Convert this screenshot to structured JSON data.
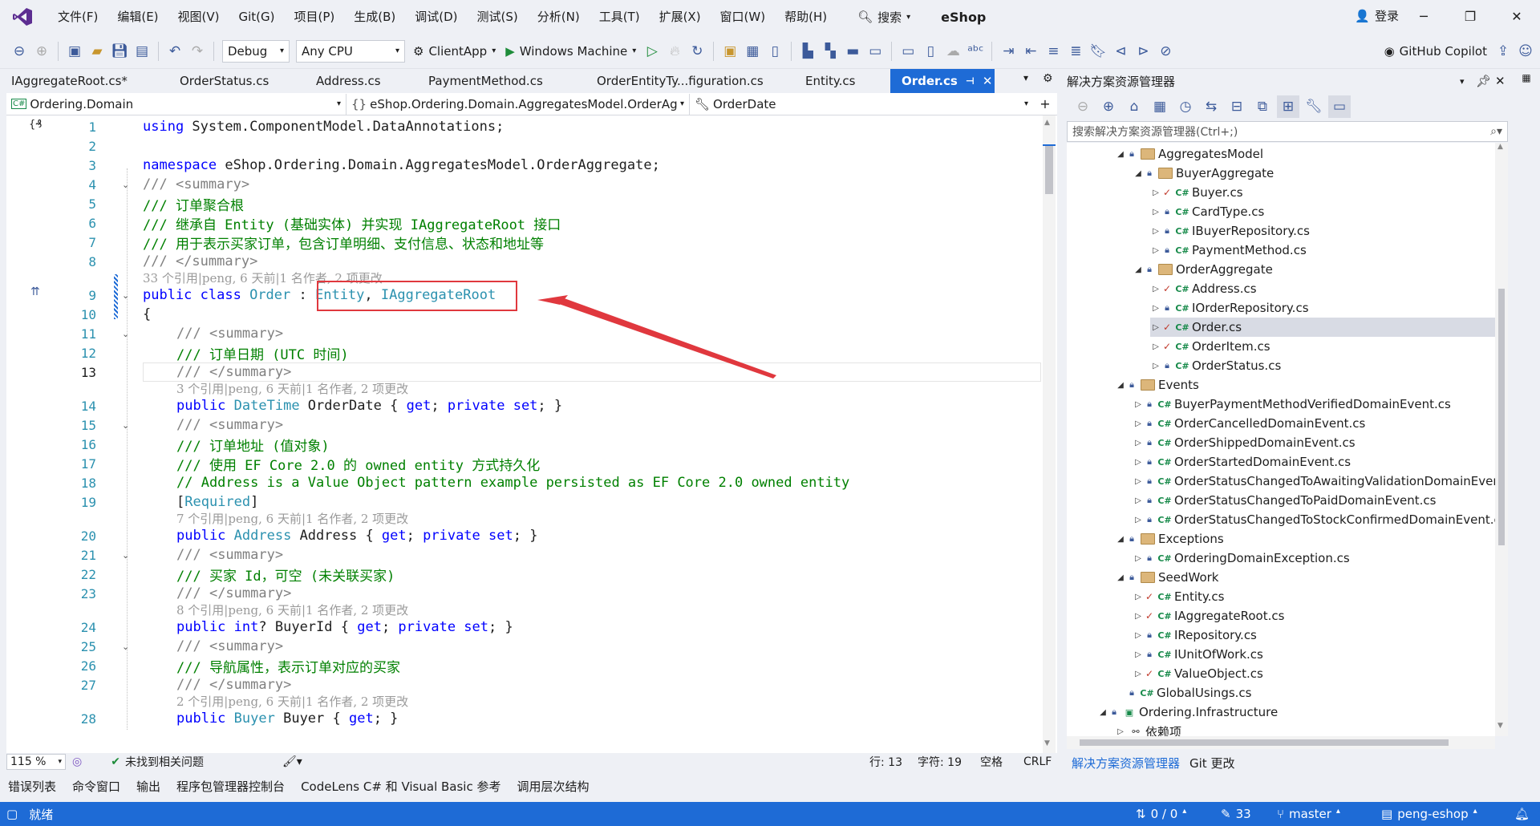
{
  "menubar": {
    "items": [
      "文件(F)",
      "编辑(E)",
      "视图(V)",
      "Git(G)",
      "项目(P)",
      "生成(B)",
      "调试(D)",
      "测试(S)",
      "分析(N)",
      "工具(T)",
      "扩展(X)",
      "窗口(W)",
      "帮助(H)"
    ],
    "search_label": "搜索",
    "app_title": "eShop",
    "login_label": "登录"
  },
  "toolbar": {
    "config": "Debug",
    "platform": "Any CPU",
    "startup": "ClientApp",
    "run_target": "Windows Machine",
    "copilot": "GitHub Copilot"
  },
  "tabs": [
    {
      "label": "IAggregateRoot.cs*"
    },
    {
      "label": "OrderStatus.cs"
    },
    {
      "label": "Address.cs"
    },
    {
      "label": "PaymentMethod.cs"
    },
    {
      "label": "OrderEntityTy...figuration.cs"
    },
    {
      "label": "Entity.cs"
    },
    {
      "label": "Order.cs"
    }
  ],
  "navbar": {
    "project": "Ordering.Domain",
    "namespace": "eShop.Ordering.Domain.AggregatesModel.OrderAg",
    "member": "OrderDate"
  },
  "editor": {
    "lines": [
      {
        "n": "1",
        "t": "using"
      },
      {
        "n": "2"
      },
      {
        "n": "3"
      },
      {
        "n": "4"
      },
      {
        "n": "5"
      },
      {
        "n": "6"
      },
      {
        "n": "7"
      },
      {
        "n": "8"
      },
      {
        "n": "9"
      },
      {
        "n": "10"
      },
      {
        "n": "11"
      },
      {
        "n": "12"
      },
      {
        "n": "13"
      },
      {
        "n": "14"
      },
      {
        "n": "15"
      },
      {
        "n": "16"
      },
      {
        "n": "17"
      },
      {
        "n": "18"
      },
      {
        "n": "19"
      },
      {
        "n": "20"
      },
      {
        "n": "21"
      },
      {
        "n": "22"
      },
      {
        "n": "23"
      },
      {
        "n": "24"
      },
      {
        "n": "25"
      },
      {
        "n": "26"
      },
      {
        "n": "27"
      },
      {
        "n": "28"
      }
    ],
    "code": {
      "l1": "using System.ComponentModel.DataAnnotations;",
      "l3a": "namespace",
      "l3b": " eShop.Ordering.Domain.AggregatesModel.OrderAggregate;",
      "l4a": "/// ",
      "l4b": "<summary>",
      "l5": "/// 订单聚合根",
      "l6": "/// 继承自 Entity (基础实体) 并实现 IAggregateRoot 接口",
      "l7": "/// 用于表示买家订单，包含订单明细、支付信息、状态和地址等",
      "l8a": "/// ",
      "l8b": "</summary>",
      "lens9": "33 个引用|peng, 6 天前|1 名作者, 2 项更改",
      "l9a": "public class",
      "l9b": "Order",
      "l9c": " : ",
      "l9d": "Entity",
      "l9e": ", ",
      "l9f": "IAggregateRoot",
      "l10": "{",
      "l11b": "<summary>",
      "l12": "/// 订单日期 (UTC 时间)",
      "l13b": "</summary>",
      "lens14": "3 个引用|peng, 6 天前|1 名作者, 2 项更改",
      "l14a": "public",
      "l14b": "DateTime",
      "l14c": " OrderDate { ",
      "l14d": "get",
      "l14e": "; ",
      "l14f": "private set",
      "l14g": "; }",
      "l16": "/// 订单地址 (值对象)",
      "l17": "/// 使用 EF Core 2.0 的 owned entity 方式持久化",
      "l18": "// Address is a Value Object pattern example persisted as EF Core 2.0 owned entity",
      "l19a": "[",
      "l19b": "Required",
      "l19c": "]",
      "lens20": "7 个引用|peng, 6 天前|1 名作者, 2 项更改",
      "l20b": "Address",
      "l20c": " Address { ",
      "l22": "/// 买家 Id，可空 (未关联买家)",
      "lens24": "8 个引用|peng, 6 天前|1 名作者, 2 项更改",
      "l24b": "int",
      "l24c": "? BuyerId { ",
      "l26": "/// 导航属性，表示订单对应的买家",
      "lens28": "2 个引用|peng, 6 天前|1 名作者, 2 项更改",
      "l28b": "Buyer",
      "l28c": " Buyer { ",
      "l28g": "; }",
      "comment_prefix": "/// "
    }
  },
  "editor_status": {
    "zoom": "115 %",
    "issues": "未找到相关问题",
    "line": "行: 13",
    "col": "字符: 19",
    "spaces": "空格",
    "eol": "CRLF"
  },
  "bottom_tabs": [
    "错误列表",
    "命令窗口",
    "输出",
    "程序包管理器控制台",
    "CodeLens C# 和 Visual Basic 参考",
    "调用层次结构"
  ],
  "statusbar": {
    "ready": "就绪",
    "sync": "0 / 0",
    "edits": "33",
    "branch": "master",
    "repo": "peng-eshop"
  },
  "solution_explorer": {
    "title": "解决方案资源管理器",
    "search_placeholder": "搜索解决方案资源管理器(Ctrl+;)",
    "tree": [
      {
        "label": "AggregatesModel",
        "level": 0,
        "type": "folder",
        "exp": "open"
      },
      {
        "label": "BuyerAggregate",
        "level": 1,
        "type": "folder",
        "exp": "open"
      },
      {
        "label": "Buyer.cs",
        "level": 2,
        "type": "cs",
        "mark": "check"
      },
      {
        "label": "CardType.cs",
        "level": 2,
        "type": "cs",
        "mark": "lock"
      },
      {
        "label": "IBuyerRepository.cs",
        "level": 2,
        "type": "cs",
        "mark": "lock"
      },
      {
        "label": "PaymentMethod.cs",
        "level": 2,
        "type": "cs",
        "mark": "lock"
      },
      {
        "label": "OrderAggregate",
        "level": 1,
        "type": "folder",
        "exp": "open"
      },
      {
        "label": "Address.cs",
        "level": 2,
        "type": "cs",
        "mark": "check"
      },
      {
        "label": "IOrderRepository.cs",
        "level": 2,
        "type": "cs",
        "mark": "lock"
      },
      {
        "label": "Order.cs",
        "level": 2,
        "type": "cs",
        "mark": "check",
        "selected": true
      },
      {
        "label": "OrderItem.cs",
        "level": 2,
        "type": "cs",
        "mark": "check"
      },
      {
        "label": "OrderStatus.cs",
        "level": 2,
        "type": "cs",
        "mark": "lock"
      },
      {
        "label": "Events",
        "level": 0,
        "type": "folder",
        "exp": "open"
      },
      {
        "label": "BuyerPaymentMethodVerifiedDomainEvent.cs",
        "level": 1,
        "type": "cs",
        "mark": "lock"
      },
      {
        "label": "OrderCancelledDomainEvent.cs",
        "level": 1,
        "type": "cs",
        "mark": "lock"
      },
      {
        "label": "OrderShippedDomainEvent.cs",
        "level": 1,
        "type": "cs",
        "mark": "lock"
      },
      {
        "label": "OrderStartedDomainEvent.cs",
        "level": 1,
        "type": "cs",
        "mark": "lock"
      },
      {
        "label": "OrderStatusChangedToAwaitingValidationDomainEven",
        "level": 1,
        "type": "cs",
        "mark": "lock"
      },
      {
        "label": "OrderStatusChangedToPaidDomainEvent.cs",
        "level": 1,
        "type": "cs",
        "mark": "lock"
      },
      {
        "label": "OrderStatusChangedToStockConfirmedDomainEvent.c",
        "level": 1,
        "type": "cs",
        "mark": "lock"
      },
      {
        "label": "Exceptions",
        "level": 0,
        "type": "folder",
        "exp": "open"
      },
      {
        "label": "OrderingDomainException.cs",
        "level": 1,
        "type": "cs",
        "mark": "lock"
      },
      {
        "label": "SeedWork",
        "level": 0,
        "type": "folder",
        "exp": "open"
      },
      {
        "label": "Entity.cs",
        "level": 1,
        "type": "cs",
        "mark": "check"
      },
      {
        "label": "IAggregateRoot.cs",
        "level": 1,
        "type": "cs",
        "mark": "check"
      },
      {
        "label": "IRepository.cs",
        "level": 1,
        "type": "cs",
        "mark": "lock"
      },
      {
        "label": "IUnitOfWork.cs",
        "level": 1,
        "type": "cs",
        "mark": "lock"
      },
      {
        "label": "ValueObject.cs",
        "level": 1,
        "type": "cs",
        "mark": "check"
      },
      {
        "label": "GlobalUsings.cs",
        "level": 0,
        "type": "cs",
        "mark": "lock",
        "noexp": true
      },
      {
        "label": "Ordering.Infrastructure",
        "level": -1,
        "type": "project",
        "exp": "open"
      },
      {
        "label": "依赖项",
        "level": 0,
        "type": "deps"
      }
    ],
    "bottom_tabs": [
      "解决方案资源管理器",
      "Git 更改"
    ]
  },
  "colors": {
    "accent": "#1e6bd6",
    "highlight_box": "#e0383e",
    "arrow": "#e0383e"
  }
}
